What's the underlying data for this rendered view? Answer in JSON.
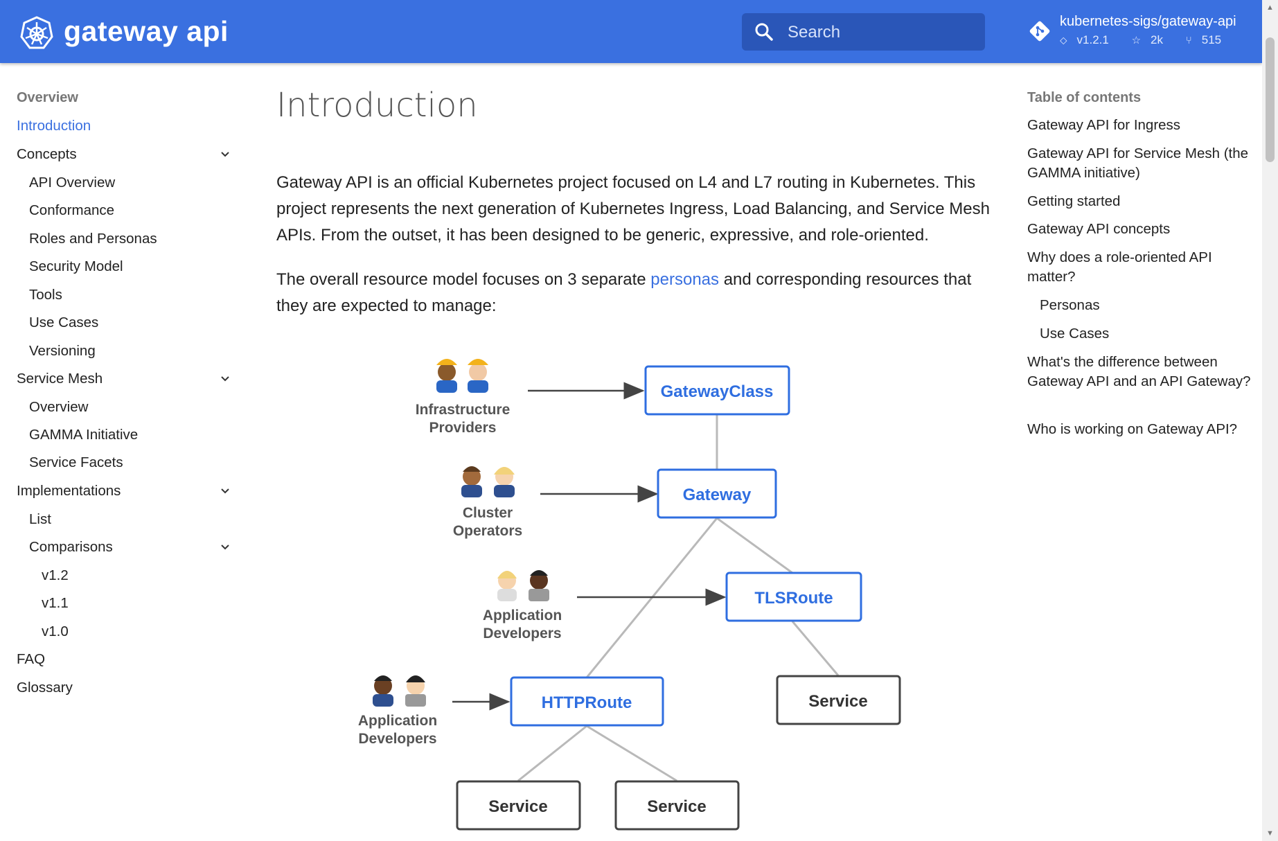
{
  "header": {
    "site_title": "gateway api",
    "search_placeholder": "Search",
    "repo_name": "kubernetes-sigs/gateway-api",
    "repo_version": "v1.2.1",
    "repo_stars": "2k",
    "repo_forks": "515",
    "bg_color": "#3a70e0"
  },
  "left_nav": {
    "items": [
      {
        "label": "Overview"
      },
      {
        "label": "Introduction"
      },
      {
        "label": "Concepts"
      },
      {
        "label": "API Overview"
      },
      {
        "label": "Conformance"
      },
      {
        "label": "Roles and Personas"
      },
      {
        "label": "Security Model"
      },
      {
        "label": "Tools"
      },
      {
        "label": "Use Cases"
      },
      {
        "label": "Versioning"
      },
      {
        "label": "Service Mesh"
      },
      {
        "label": "Overview"
      },
      {
        "label": "GAMMA Initiative"
      },
      {
        "label": "Service Facets"
      },
      {
        "label": "Implementations"
      },
      {
        "label": "List"
      },
      {
        "label": "Comparisons"
      },
      {
        "label": "v1.2"
      },
      {
        "label": "v1.1"
      },
      {
        "label": "v1.0"
      },
      {
        "label": "FAQ"
      },
      {
        "label": "Glossary"
      }
    ]
  },
  "main": {
    "title": "Introduction",
    "para1": "Gateway API is an official Kubernetes project focused on L4 and L7 routing in Kubernetes. This project represents the next generation of Kubernetes Ingress, Load Balancing, and Service Mesh APIs. From the outset, it has been designed to be generic, expressive, and role-oriented.",
    "para2_before": "The overall resource model focuses on 3 separate ",
    "para2_link": "personas",
    "para2_after": " and corresponding resources that they are expected to manage:"
  },
  "diagram": {
    "resources": {
      "gatewayclass": "GatewayClass",
      "gateway": "Gateway",
      "tlsroute": "TLSRoute",
      "httproute": "HTTPRoute",
      "service": "Service"
    },
    "personas": {
      "infra_line1": "Infrastructure",
      "infra_line2": "Providers",
      "cluster_line1": "Cluster",
      "cluster_line2": "Operators",
      "appdev_line1": "Application",
      "appdev_line2": "Developers"
    },
    "resource_color": "#2f6ee0"
  },
  "toc": {
    "heading": "Table of contents",
    "items": [
      {
        "label": "Gateway API for Ingress"
      },
      {
        "label": "Gateway API for Service Mesh (the GAMMA initiative)"
      },
      {
        "label": "Getting started"
      },
      {
        "label": "Gateway API concepts"
      },
      {
        "label": "Why does a role-oriented API matter?"
      },
      {
        "label": "Personas"
      },
      {
        "label": "Use Cases"
      },
      {
        "label": "What's the difference between Gateway API and an API Gateway?"
      },
      {
        "label": "Who is working on Gateway API?"
      }
    ]
  }
}
